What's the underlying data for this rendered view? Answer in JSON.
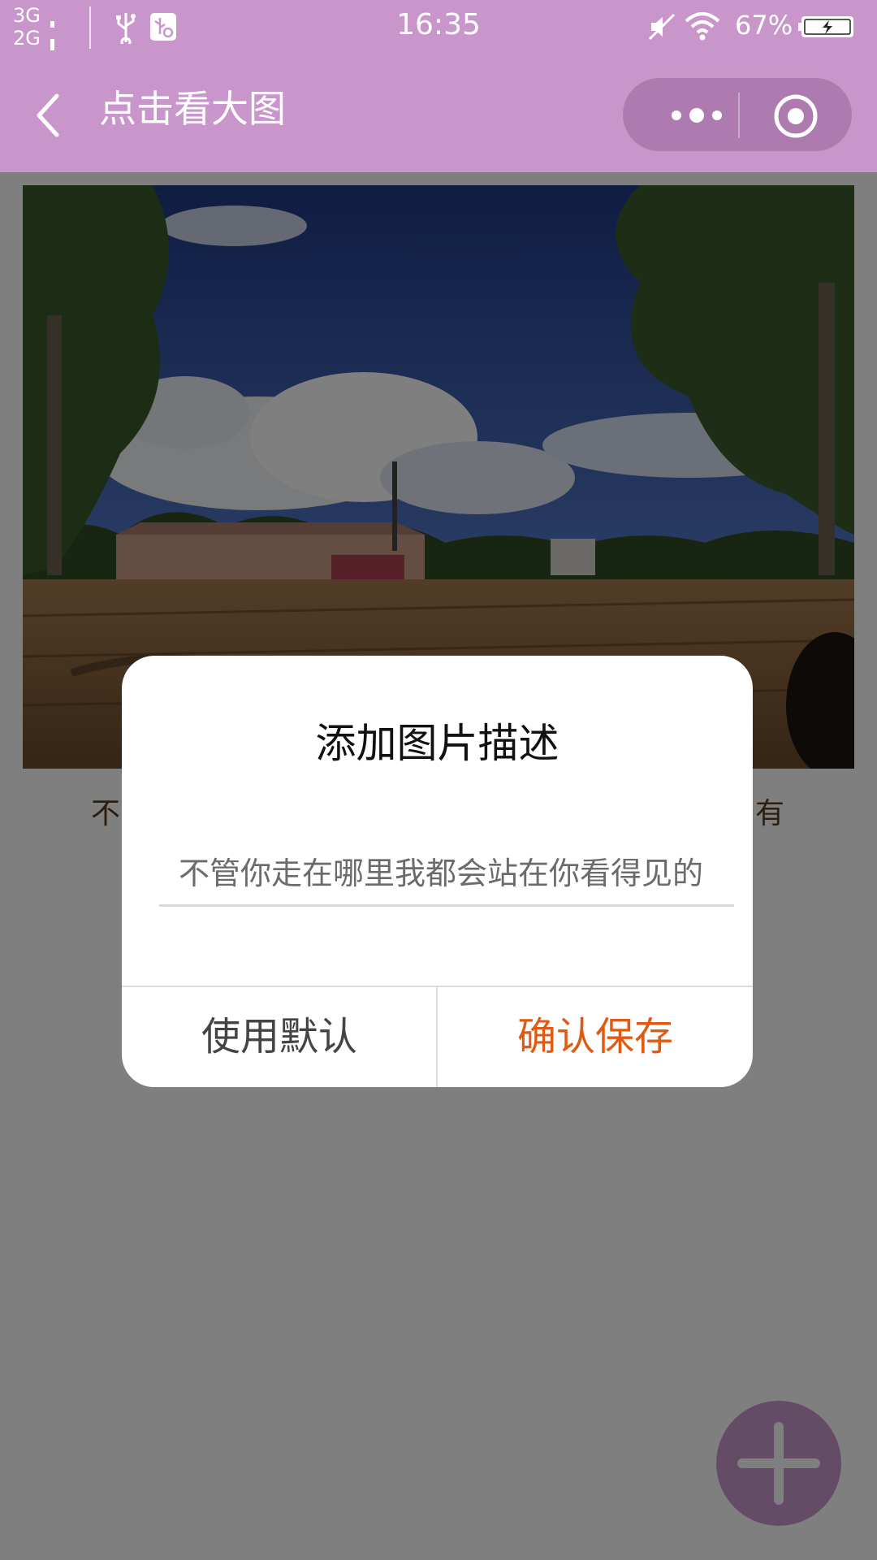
{
  "status_bar": {
    "network_top": "3G",
    "network_bottom": "2G",
    "time": "16:35",
    "battery_percent": "67%",
    "icons": [
      "usb-icon",
      "usb-debug-icon",
      "mute-icon",
      "wifi-icon",
      "battery-icon"
    ]
  },
  "nav": {
    "title": "点击看大图",
    "back_icon": "chevron-left-icon",
    "capsule_icons": [
      "more-dots-icon",
      "close-target-icon"
    ]
  },
  "content": {
    "caption_left": "不",
    "caption_right": "有",
    "photo_description_icon": "landscape-photo"
  },
  "dialog": {
    "title": "添加图片描述",
    "input_placeholder": "不管你走在哪里我都会站在你看得见的",
    "btn_default": "使用默认",
    "btn_confirm": "确认保存"
  },
  "fab": {
    "icon": "plus-icon"
  },
  "colors": {
    "brand": "#c996cc",
    "confirm": "#e15a14",
    "caption": "#5a3d1f"
  }
}
